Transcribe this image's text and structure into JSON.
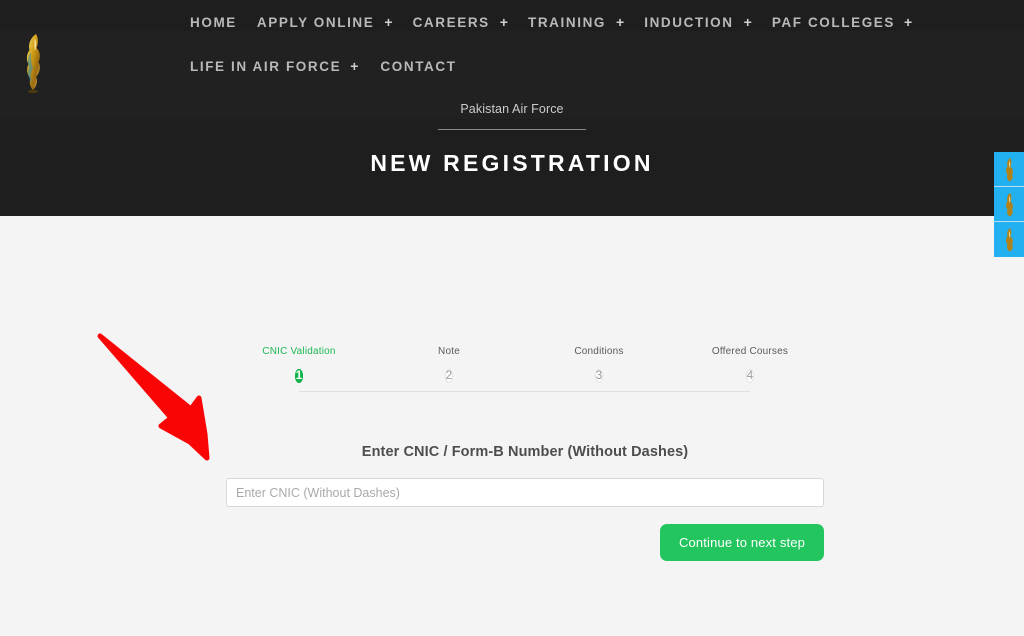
{
  "header": {
    "logo_icon": "paf-eagle-emblem-icon",
    "nav_rows": [
      [
        {
          "label": "HOME",
          "has_submenu": false
        },
        {
          "label": "APPLY ONLINE",
          "has_submenu": true
        },
        {
          "label": "CAREERS",
          "has_submenu": true
        },
        {
          "label": "TRAINING",
          "has_submenu": true
        },
        {
          "label": "INDUCTION",
          "has_submenu": true
        },
        {
          "label": "PAF COLLEGES",
          "has_submenu": true
        }
      ],
      [
        {
          "label": "LIFE IN AIR FORCE",
          "has_submenu": true
        },
        {
          "label": "CONTACT",
          "has_submenu": false
        }
      ]
    ],
    "submenu_symbol": "+",
    "breadcrumb": "Pakistan Air Force",
    "page_title": "NEW REGISTRATION"
  },
  "side_widgets": [
    {
      "icon": "paf-emblem-icon",
      "label": ""
    },
    {
      "icon": "paf-emblem-icon",
      "label": ""
    },
    {
      "icon": "paf-emblem-icon",
      "label": ""
    }
  ],
  "stepper": {
    "steps": [
      {
        "number": "1",
        "label": "CNIC Validation",
        "active": true
      },
      {
        "number": "2",
        "label": "Note",
        "active": false
      },
      {
        "number": "3",
        "label": "Conditions",
        "active": false
      },
      {
        "number": "4",
        "label": "Offered Courses",
        "active": false
      }
    ]
  },
  "form": {
    "field_label": "Enter CNIC / Form-B Number (Without Dashes)",
    "cnic_placeholder": "Enter CNIC (Without Dashes)",
    "cnic_value": "",
    "submit_label": "Continue to next step"
  },
  "annotation": {
    "arrow_icon": "red-pointer-arrow-icon",
    "arrow_color": "#fa0505",
    "points_at": "cnic-input"
  },
  "colors": {
    "header_bg": "#1e1e1e",
    "nav_bg": "#212121",
    "page_bg": "#f4f4f4",
    "accent_green": "#13b34a",
    "button_green": "#22c55e",
    "side_widget_cyan": "#22b0f0"
  }
}
